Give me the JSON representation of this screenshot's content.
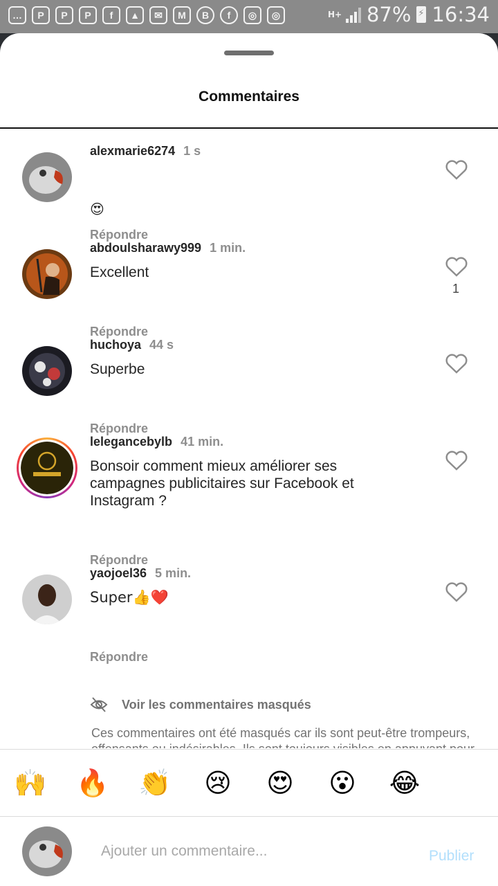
{
  "status_bar": {
    "battery": "87%",
    "time": "16:34",
    "network": "H+",
    "notification_icons": [
      "messages-icon",
      "p-icon",
      "p-icon",
      "p-icon",
      "facebook-icon",
      "gallery-icon",
      "email-icon",
      "gmail-icon",
      "b-icon",
      "facebook-circle-icon",
      "instagram-icon",
      "instagram-icon"
    ]
  },
  "sheet": {
    "title": "Commentaires"
  },
  "comments": [
    {
      "username": "alexmarie6274",
      "time": "1 s",
      "text": "😍",
      "reply": "Répondre",
      "likes": "",
      "avatar_color": "#8a8a8a"
    },
    {
      "username": "abdoulsharawy999",
      "time": "1 min.",
      "text": "Excellent",
      "reply": "Répondre",
      "likes": "1",
      "avatar_color": "#6b3a12"
    },
    {
      "username": "huchoya",
      "time": "44 s",
      "text": "Superbe",
      "reply": "Répondre",
      "likes": "",
      "avatar_color": "#1b1b22"
    },
    {
      "username": "lelegancebylb",
      "time": "41 min.",
      "text": "Bonsoir comment mieux améliorer ses campagnes publicitaires sur Facebook et Instagram ?",
      "reply": "Répondre",
      "likes": "",
      "avatar_color": "#2a2408"
    },
    {
      "username": "yaojoel36",
      "time": "5 min.",
      "text": "Super👍❤️",
      "reply": "Répondre",
      "likes": "",
      "avatar_color": "#cfcfcf"
    }
  ],
  "hidden": {
    "link_label": "Voir les commentaires masqués",
    "note": "Ces commentaires ont été masqués car ils sont peut-être trompeurs, offensants ou indésirables. Ils sont toujours visibles en appuyant pour les voir."
  },
  "emoji_bar": [
    "🙌",
    "🔥",
    "👏",
    "😢",
    "😍",
    "😮",
    "😂"
  ],
  "composer": {
    "placeholder": "Ajouter un commentaire...",
    "value": "",
    "publish_label": "Publier"
  },
  "colors": {
    "accent_disabled": "#b2dffc",
    "meta_text": "#8e8e8e"
  }
}
